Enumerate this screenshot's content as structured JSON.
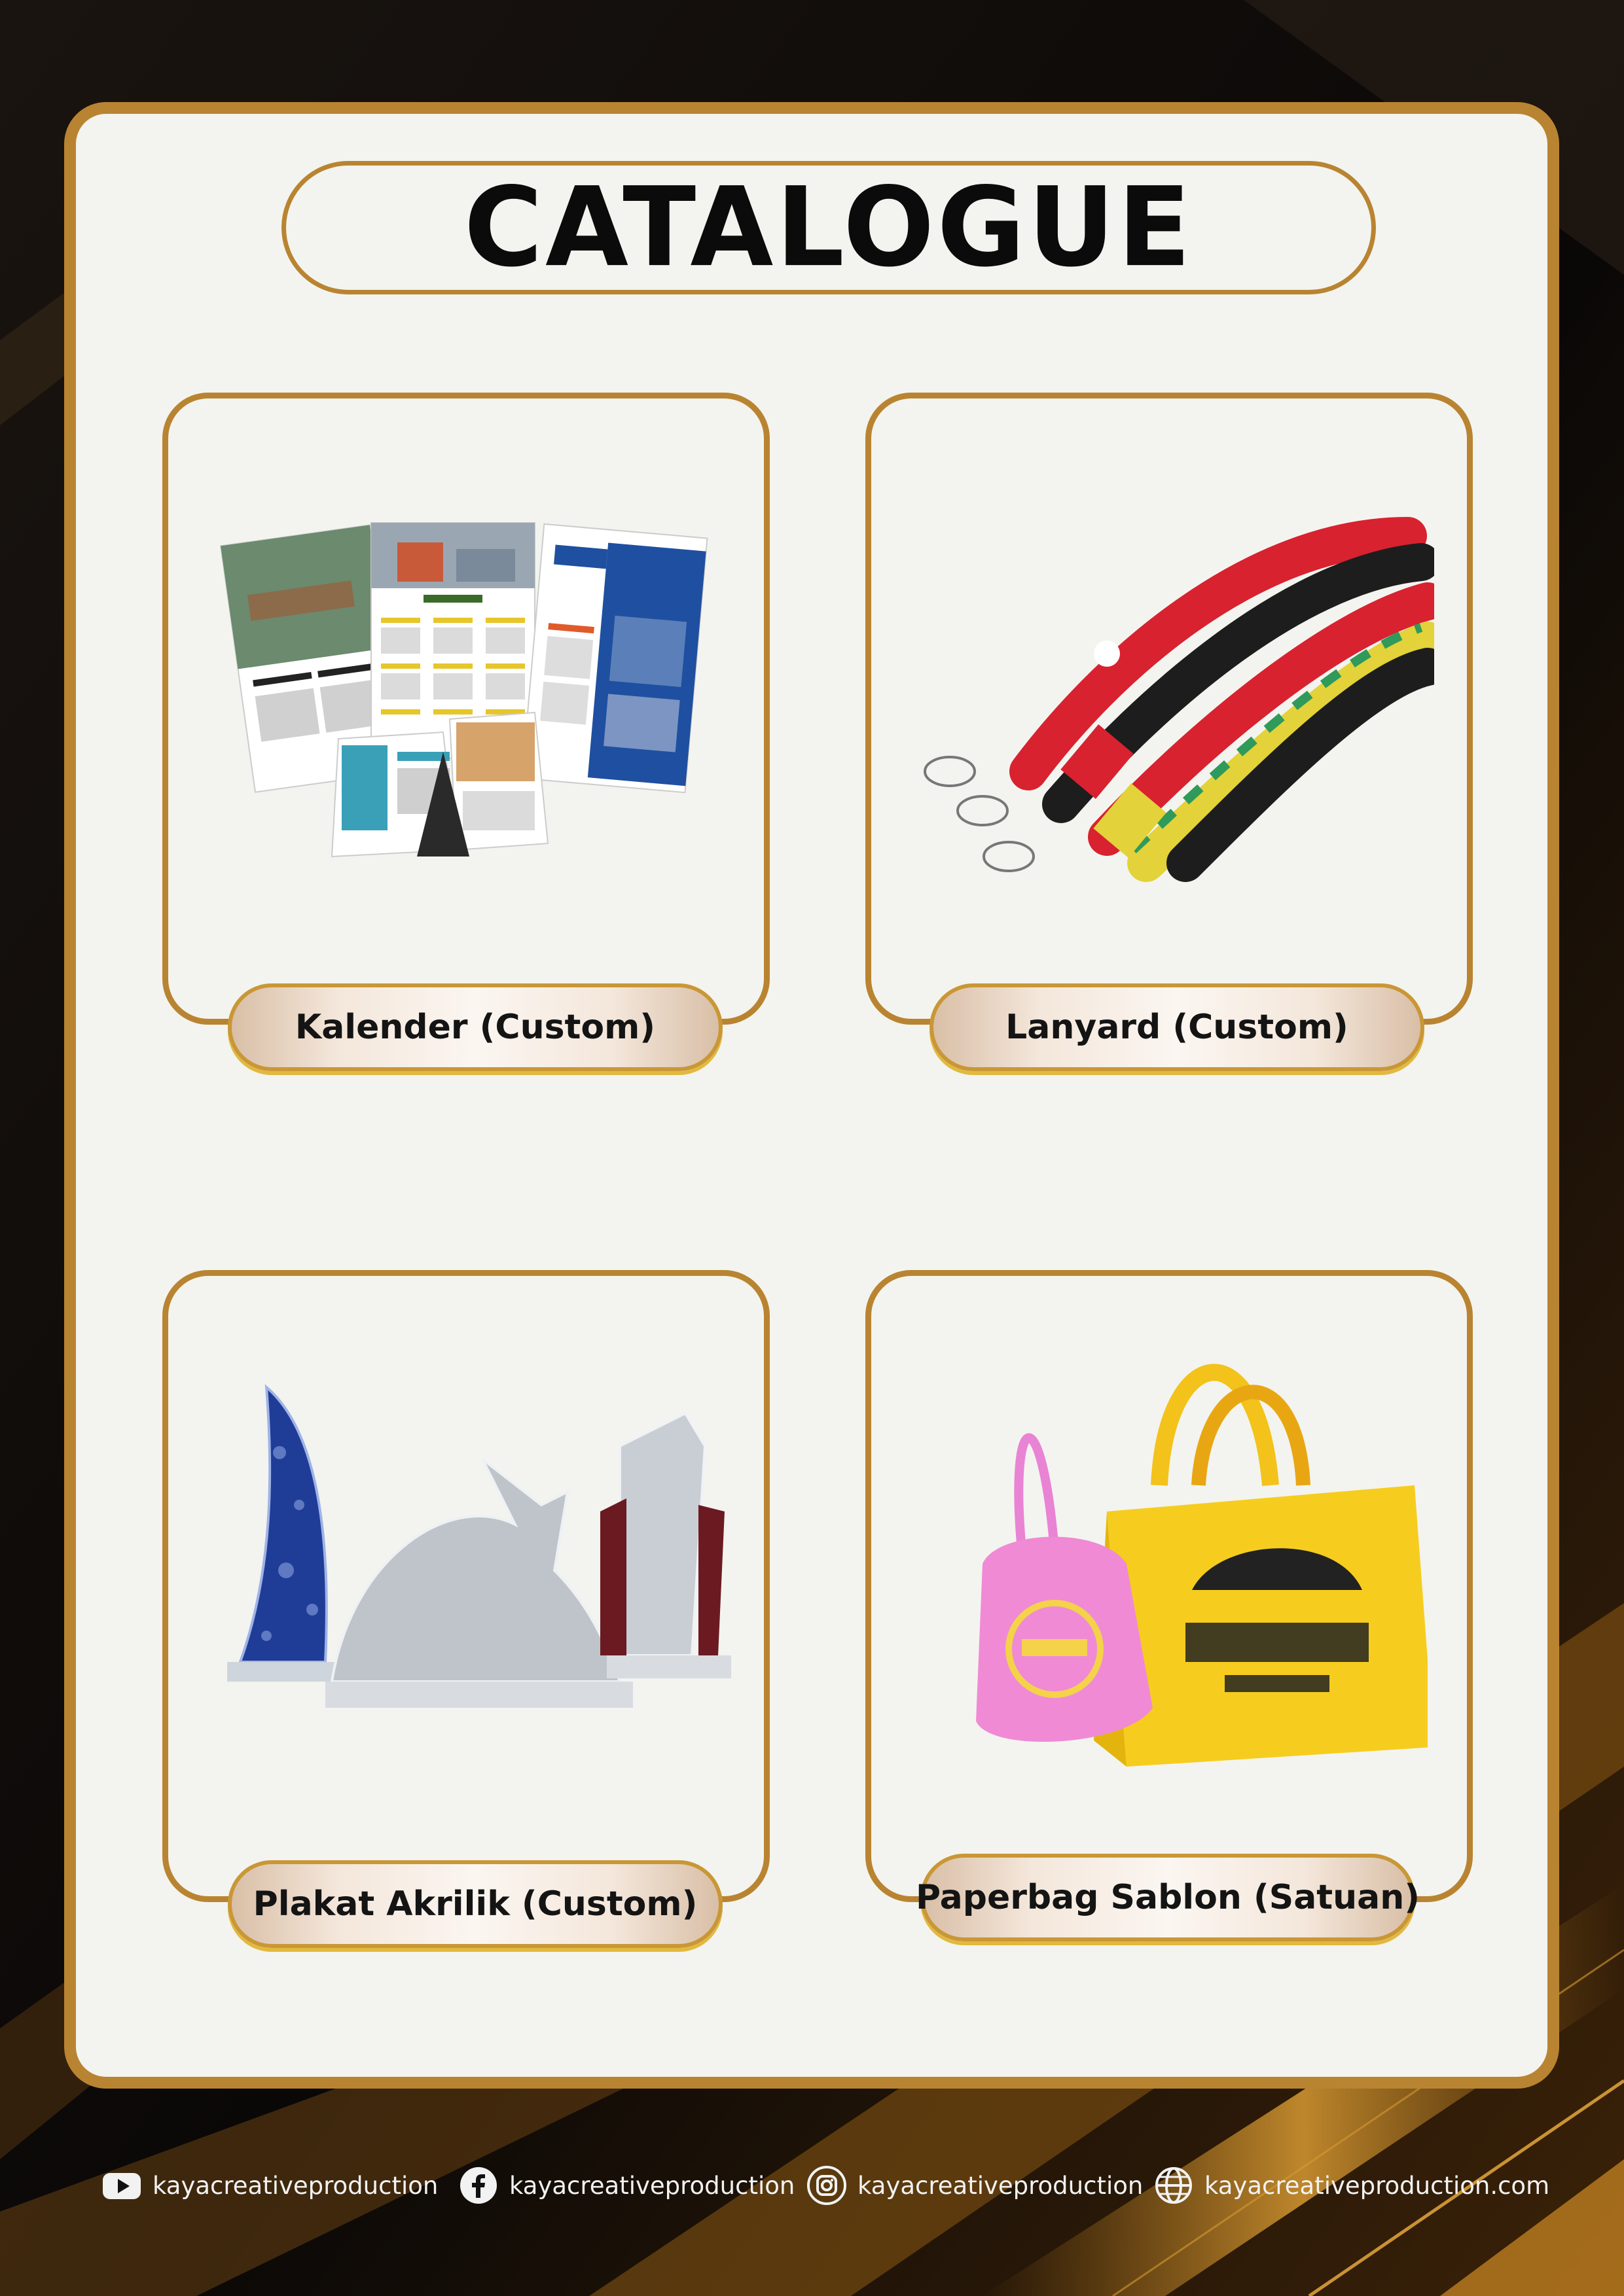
{
  "header": {
    "title": "CATALOGUE"
  },
  "products": [
    {
      "label": "Kalender (Custom)",
      "image_icon": "calendar-products-image"
    },
    {
      "label": "Lanyard (Custom)",
      "image_icon": "lanyard-products-image"
    },
    {
      "label": "Plakat Akrilik (Custom)",
      "image_icon": "acrylic-plaque-image"
    },
    {
      "label": "Paperbag Sablon (Satuan)",
      "image_icon": "paperbag-image"
    }
  ],
  "footer": {
    "youtube": {
      "icon": "youtube-icon",
      "text": "kayacreativeproduction"
    },
    "facebook": {
      "icon": "facebook-icon",
      "text": "kayacreativeproduction"
    },
    "instagram": {
      "icon": "instagram-icon",
      "text": "kayacreativeproduction"
    },
    "website": {
      "icon": "globe-icon",
      "text": "kayacreativeproduction.com"
    }
  },
  "colors": {
    "gold": "#b98431",
    "panel": "#f3f4ef",
    "background": "#0b0908"
  }
}
